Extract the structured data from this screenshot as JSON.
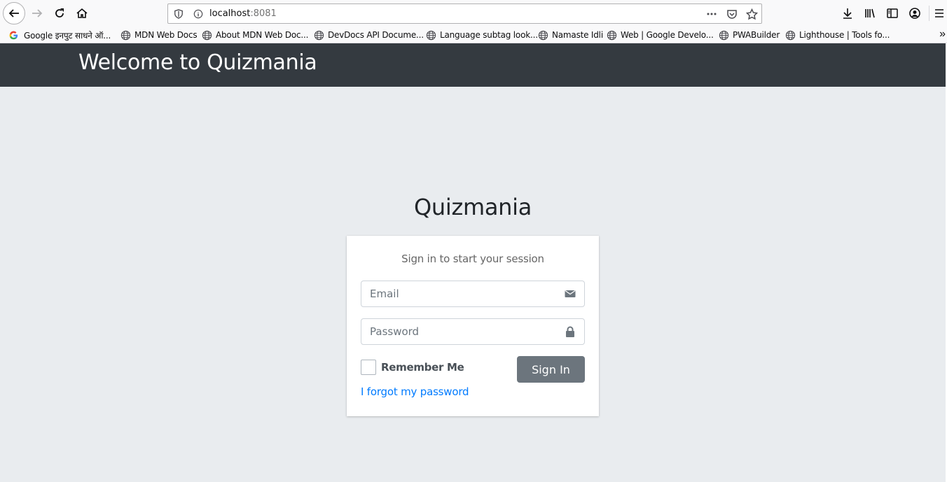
{
  "browser": {
    "url_host": "localhost",
    "url_port": ":8081",
    "bookmarks": [
      {
        "label": "Google इनपुट साधने ऑ...",
        "icon": "google-icon"
      },
      {
        "label": "MDN Web Docs",
        "icon": "globe-icon"
      },
      {
        "label": "About MDN Web Doc...",
        "icon": "globe-icon"
      },
      {
        "label": "DevDocs API Docume...",
        "icon": "globe-icon"
      },
      {
        "label": "Language subtag look...",
        "icon": "globe-icon"
      },
      {
        "label": "Namaste Idli",
        "icon": "globe-icon"
      },
      {
        "label": "Web | Google Develo...",
        "icon": "globe-icon"
      },
      {
        "label": "PWABuilder",
        "icon": "globe-icon"
      },
      {
        "label": "Lighthouse | Tools fo...",
        "icon": "globe-icon"
      }
    ],
    "more_label": "»"
  },
  "navbar": {
    "brand": "Welcome to Quizmania",
    "background": "#343a40"
  },
  "login": {
    "title": "Quizmania",
    "message": "Sign in to start your session",
    "email_placeholder": "Email",
    "password_placeholder": "Password",
    "remember_label": "Remember Me",
    "signin_label": "Sign In",
    "forgot_label": "I forgot my password"
  },
  "colors": {
    "page_bg": "#e9ecef",
    "button": "#6c757d",
    "link": "#007bff"
  }
}
